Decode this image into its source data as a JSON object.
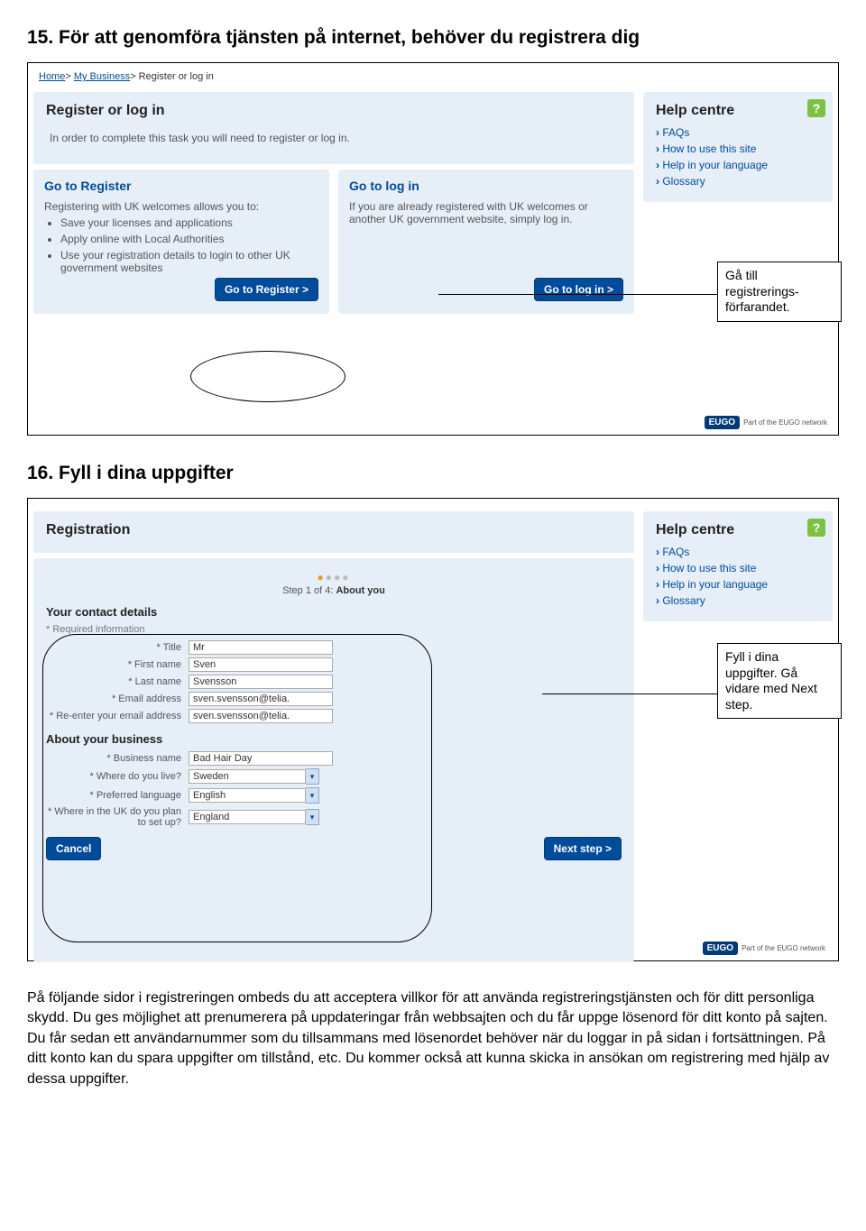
{
  "doc": {
    "heading15": "15. För att genomföra tjänsten på internet, behöver du registrera dig",
    "heading16": "16. Fyll i dina uppgifter",
    "para": "På följande sidor i registreringen ombeds du att acceptera villkor för att använda registreringstjänsten och för ditt personliga skydd. Du ges möjlighet att prenumerera på uppdateringar från webbsajten och du får uppge lösenord för ditt konto på sajten. Du får sedan ett användarnummer som du tillsammans med lösenordet behöver när du loggar in på sidan i fortsättningen. På ditt konto kan du spara uppgifter om tillstånd, etc. Du kommer också att kunna skicka in ansökan om registrering med hjälp av dessa uppgifter."
  },
  "callouts": {
    "c1": "Gå till registrerings-förfarandet.",
    "c2": "Fyll i dina uppgifter. Gå vidare med Next step."
  },
  "shotA": {
    "breadcrumbs": {
      "home": "Home",
      "mybiz": "My Business",
      "current": "Register or log in"
    },
    "main_title": "Register or log in",
    "intro": "In order to complete this task you will need to register or log in.",
    "register": {
      "headline": "Go to Register",
      "lead": "Registering with UK welcomes allows you to:",
      "items": [
        "Save your licenses and applications",
        "Apply online with Local Authorities",
        "Use your registration details to login to other UK government websites"
      ],
      "button": "Go to Register >"
    },
    "login": {
      "headline": "Go to log in",
      "lead": "If you are already registered with UK welcomes or another UK government website, simply log in.",
      "button": "Go to log in >"
    }
  },
  "help": {
    "title": "Help centre",
    "items": [
      "FAQs",
      "How to use this site",
      "Help in your language",
      "Glossary"
    ]
  },
  "eugo": {
    "badge": "EUGO",
    "text": "Part of the EUGO network"
  },
  "shotB": {
    "title": "Registration",
    "step_line_pre": "Step 1 of 4: ",
    "step_line_b": "About you",
    "section1": "Your contact details",
    "req": "* Required information",
    "fields1": [
      {
        "label": "* Title",
        "value": "Mr"
      },
      {
        "label": "* First name",
        "value": "Sven"
      },
      {
        "label": "* Last name",
        "value": "Svensson"
      },
      {
        "label": "* Email address",
        "value": "sven.svensson@telia."
      },
      {
        "label": "* Re-enter your email address",
        "value": "sven.svensson@telia."
      }
    ],
    "section2": "About your business",
    "fields2": [
      {
        "label": "* Business name",
        "value": "Bad Hair Day",
        "type": "text"
      },
      {
        "label": "* Where do you live?",
        "value": "Sweden",
        "type": "select"
      },
      {
        "label": "* Preferred language",
        "value": "English",
        "type": "select"
      },
      {
        "label": "* Where in the UK do you plan to set up?",
        "value": "England",
        "type": "select"
      }
    ],
    "cancel": "Cancel",
    "next": "Next step >"
  }
}
